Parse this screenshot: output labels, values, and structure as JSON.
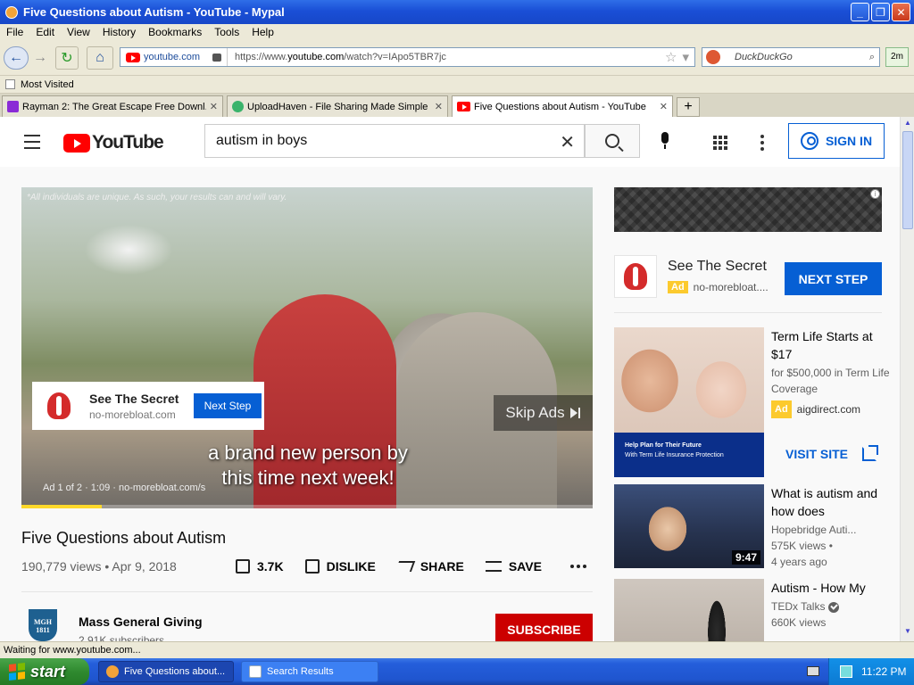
{
  "window": {
    "title": "Five Questions about Autism - YouTube - Mypal"
  },
  "menu": [
    "File",
    "Edit",
    "View",
    "History",
    "Bookmarks",
    "Tools",
    "Help"
  ],
  "urlbar": {
    "site": "youtube.com",
    "url_prefix": "https://www.",
    "url_domain": "youtube.com",
    "url_path": "/watch?v=IApo5TBR7jc"
  },
  "browser_search": {
    "placeholder": "DuckDuckGo"
  },
  "toolbar": {
    "extra_button": "2m"
  },
  "bookmarks": {
    "most_visited": "Most Visited"
  },
  "tabs": [
    {
      "title": "Rayman 2: The Great Escape Free Downl...",
      "icon_color": "#8a2bd6"
    },
    {
      "title": "UploadHaven - File Sharing Made Simple",
      "icon_color": "#3ab36b"
    },
    {
      "title": "Five Questions about Autism - YouTube",
      "icon_color": "#ff0000",
      "active": true
    }
  ],
  "youtube": {
    "logo_text": "YouTube",
    "search_value": "autism in boys",
    "sign_in": "SIGN IN"
  },
  "player": {
    "disclaimer": "*All individuals are unique. As such, your results can and will vary.",
    "ad_title": "See The Secret",
    "ad_domain": "no-morebloat.com",
    "ad_button": "Next Step",
    "skip_label": "Skip Ads",
    "caption": "a brand new person by this time next week!",
    "ad_progress_text": "Ad 1 of 2 · 1:09 · no-morebloat.com/s",
    "progress_fraction": 0.14
  },
  "video": {
    "title": "Five Questions about Autism",
    "meta": "190,779 views • Apr 9, 2018",
    "likes": "3.7K",
    "dislike": "DISLIKE",
    "share": "SHARE",
    "save": "SAVE"
  },
  "channel": {
    "avatar_text": "MGH 1811",
    "name": "Mass General Giving",
    "subscribers": "2.91K subscribers",
    "subscribe": "SUBSCRIBE"
  },
  "side_ad": {
    "title": "See The Secret",
    "badge": "Ad",
    "domain": "no-morebloat....",
    "button": "NEXT STEP",
    "info_icon": "i"
  },
  "term_ad": {
    "title": "Term Life Starts at $17",
    "desc": "for $500,000 in Term Life Coverage",
    "badge": "Ad",
    "domain": "aigdirect.com",
    "banner_line1": "Help Plan for Their Future",
    "banner_line2": "With Term Life Insurance Protection",
    "button": "VISIT SITE"
  },
  "recommendations": [
    {
      "title": "What is autism and how does",
      "channel": "Hopebridge Auti...",
      "views": "575K views •",
      "age": "4 years ago",
      "duration": "9:47"
    },
    {
      "title": "Autism - How My",
      "channel": "TEDx Talks",
      "views": "660K views"
    }
  ],
  "status": {
    "text": "Waiting for www.youtube.com..."
  },
  "taskbar": {
    "start": "start",
    "tasks": [
      "Five Questions about...",
      "Search Results"
    ],
    "clock": "11:22 PM"
  }
}
